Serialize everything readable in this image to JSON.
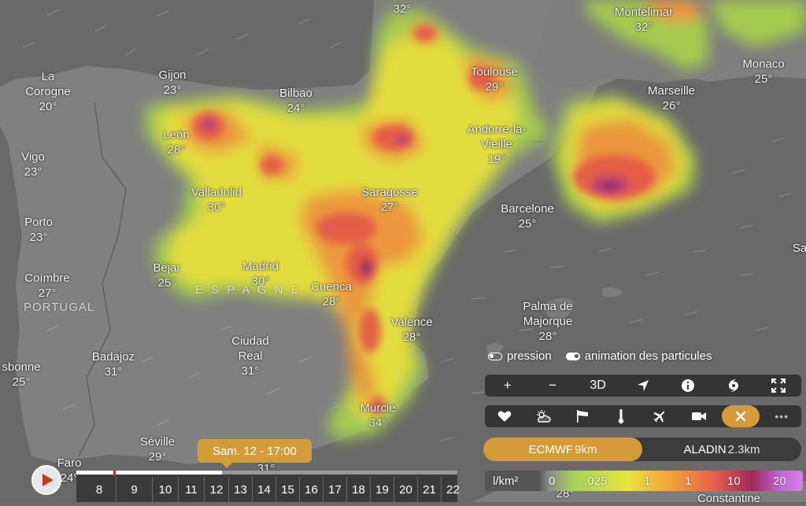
{
  "cities": [
    {
      "key": "perpignan",
      "name": "",
      "temp": "32°"
    },
    {
      "key": "montelimar",
      "name": "Montélimar",
      "temp": "32°"
    },
    {
      "key": "monaco",
      "name": "Monaco",
      "temp": "25°"
    },
    {
      "key": "marseille",
      "name": "Marseille",
      "temp": "26°"
    },
    {
      "key": "toulouse",
      "name": "Toulouse",
      "temp": "29°"
    },
    {
      "key": "lacorogne",
      "name": "La\nCorogne",
      "temp": "20°"
    },
    {
      "key": "gijon",
      "name": "Gijon",
      "temp": "23°"
    },
    {
      "key": "bilbao",
      "name": "Bilbao",
      "temp": "24°"
    },
    {
      "key": "andorre",
      "name": "Andorre-la-\nVieille",
      "temp": "19°"
    },
    {
      "key": "leon",
      "name": "León",
      "temp": "28°"
    },
    {
      "key": "vigo",
      "name": "Vigo",
      "temp": "23°"
    },
    {
      "key": "valladolid",
      "name": "Valladolid",
      "temp": "30°"
    },
    {
      "key": "saragosse",
      "name": "Saragosse",
      "temp": "27°"
    },
    {
      "key": "barcelone",
      "name": "Barcelone",
      "temp": "25°"
    },
    {
      "key": "porto",
      "name": "Porto",
      "temp": "23°"
    },
    {
      "key": "bejar",
      "name": "Béjar",
      "temp": "25°"
    },
    {
      "key": "madrid",
      "name": "Madrid",
      "temp": "30°"
    },
    {
      "key": "cuenca",
      "name": "Cuenca",
      "temp": "28°"
    },
    {
      "key": "coimbre",
      "name": "Coïmbre",
      "temp": "27°"
    },
    {
      "key": "palma",
      "name": "Palma de\nMajorque",
      "temp": "28°"
    },
    {
      "key": "valence",
      "name": "Valence",
      "temp": "28°"
    },
    {
      "key": "ciudadreal",
      "name": "Ciudad\nReal",
      "temp": "31°"
    },
    {
      "key": "badajoz",
      "name": "Badajoz",
      "temp": "31°"
    },
    {
      "key": "lisbonne",
      "name": "sbonne",
      "temp": "25°"
    },
    {
      "key": "murcie",
      "name": "Murcie",
      "temp": "34°"
    },
    {
      "key": "seville",
      "name": "Séville",
      "temp": "29°"
    },
    {
      "key": "faro",
      "name": "Faro",
      "temp": "24°"
    },
    {
      "key": "malaga",
      "name": "",
      "temp": "31°"
    },
    {
      "key": "alger",
      "name": "",
      "temp": "28°"
    },
    {
      "key": "constantine",
      "name": "Constantine",
      "temp": ""
    },
    {
      "key": "sa",
      "name": "Sa",
      "temp": ""
    }
  ],
  "countries": {
    "spain": "E S P A G N E",
    "portugal": "PORTUGAL"
  },
  "toggles": {
    "pressure": "pression",
    "particles": "animation des particules"
  },
  "toolbar": {
    "zoom_in": "+",
    "zoom_out": "−",
    "three_d": "3D",
    "more": "•••"
  },
  "models": {
    "ecmwf": "ECMWF",
    "ecmwf_res": "9km",
    "aladin": "ALADIN",
    "aladin_res": "2.3km"
  },
  "legend": {
    "unit": "l/km²",
    "stops": [
      "0",
      ".025",
      ".1",
      "1",
      "10",
      "20"
    ]
  },
  "timeline": {
    "tooltip": "Sam. 12 - 17:00",
    "hours": [
      "8",
      "9",
      "10",
      "11",
      "12",
      "13",
      "14",
      "15",
      "16",
      "17",
      "18",
      "19",
      "20",
      "21",
      "22"
    ]
  },
  "colors": {
    "accent": "#d39b3a",
    "sea": "#6b6b6b",
    "land": "#818181"
  }
}
